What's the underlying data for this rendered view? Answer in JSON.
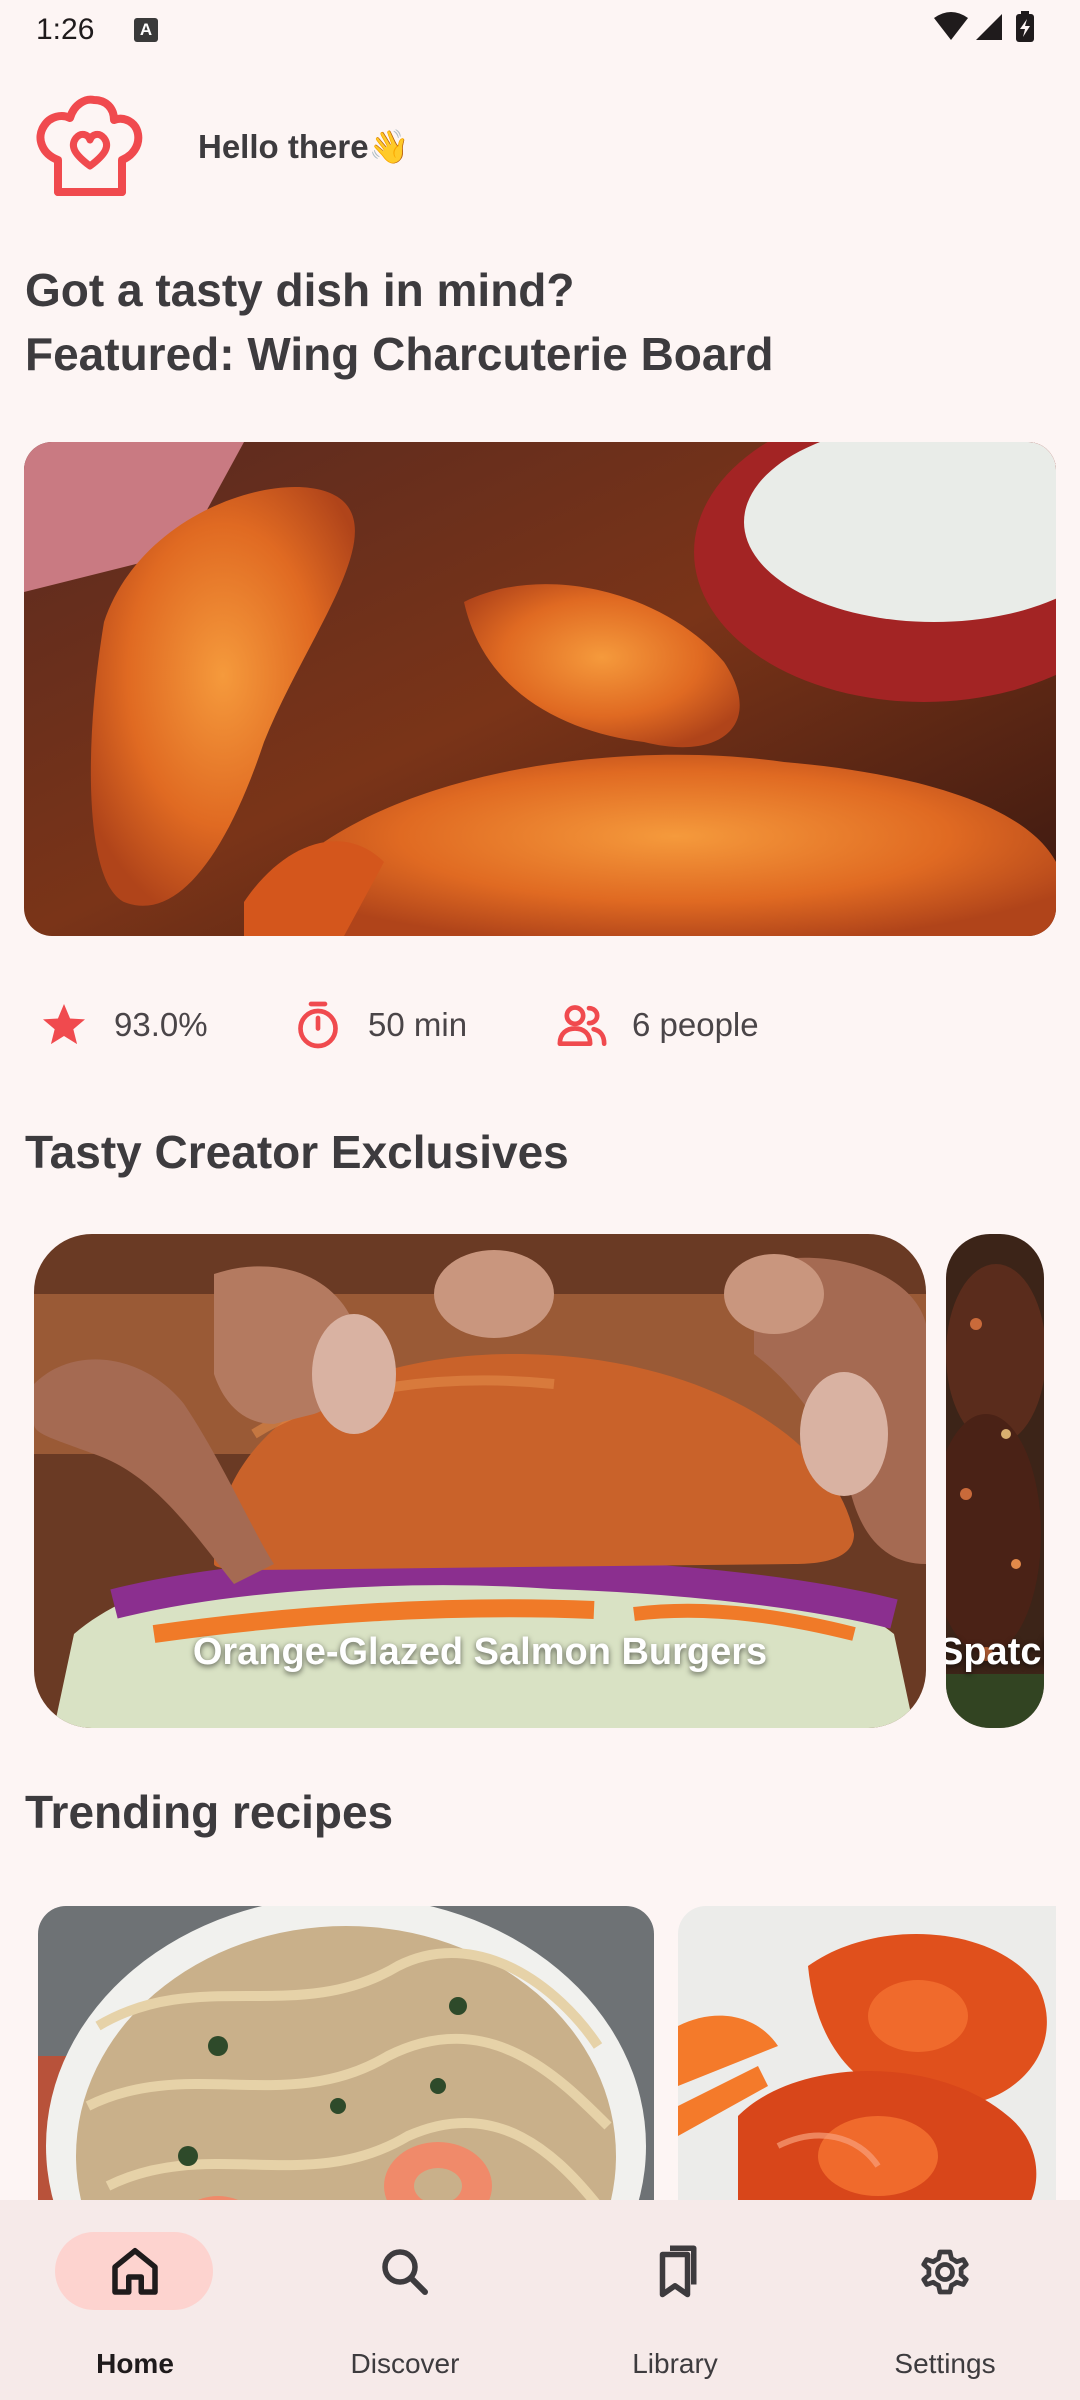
{
  "status_bar": {
    "time": "1:26",
    "notification_icon": "a-badge-icon",
    "icons": [
      "wifi-icon",
      "signal-icon",
      "battery-charging-icon"
    ]
  },
  "header": {
    "logo_icon": "chef-hat-heart-icon",
    "greeting": "Hello there👋"
  },
  "prompt": "Got a tasty dish in mind?",
  "featured": {
    "title": "Featured: Wing Charcuterie Board",
    "image": "chicken-wings-with-dip",
    "rating": "93.0%",
    "time": "50 min",
    "servings": "6 people"
  },
  "creator_exclusives": {
    "title": "Tasty Creator Exclusives",
    "cards": [
      {
        "label": "Orange-Glazed Salmon Burgers",
        "image": "salmon-burger"
      },
      {
        "label": "Spatch",
        "image": "spatchcock-chicken"
      }
    ]
  },
  "trending": {
    "title": "Trending recipes",
    "cards": [
      {
        "image": "shrimp-pasta"
      },
      {
        "image": "buffalo-chicken"
      }
    ]
  },
  "nav": {
    "items": [
      {
        "label": "Home",
        "icon": "home-icon",
        "active": true
      },
      {
        "label": "Discover",
        "icon": "search-icon",
        "active": false
      },
      {
        "label": "Library",
        "icon": "bookmarks-icon",
        "active": false
      },
      {
        "label": "Settings",
        "icon": "gear-icon",
        "active": false
      }
    ]
  },
  "colors": {
    "accent": "#F04A4E",
    "background": "#FDF5F4",
    "nav_background": "#F6EAE9",
    "nav_active_pill": "#FDD3CF"
  }
}
